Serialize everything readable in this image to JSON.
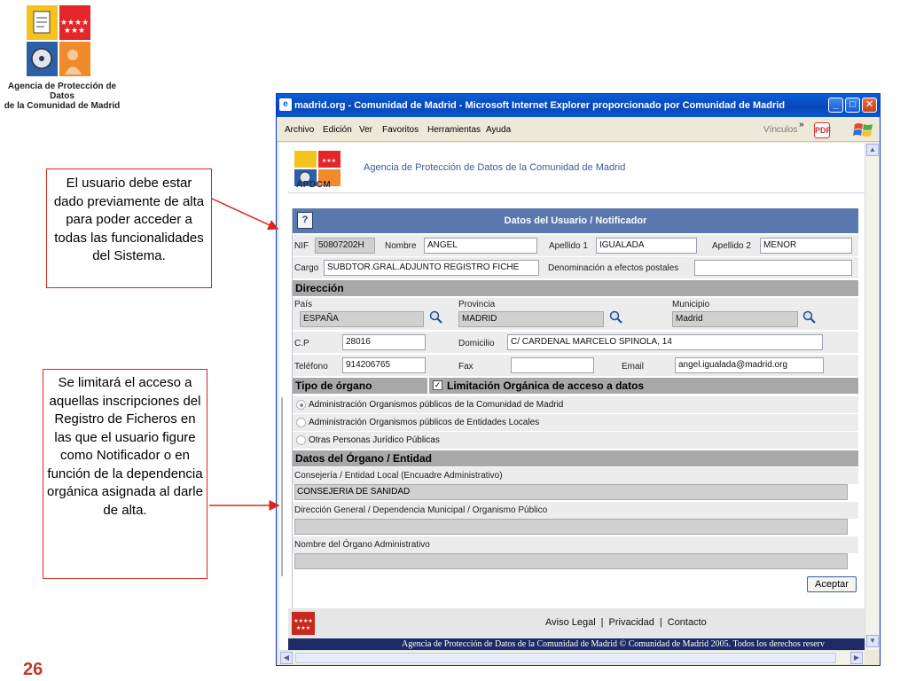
{
  "slide": {
    "logo_caption_line1": "Agencia de Protección de Datos",
    "logo_caption_line2": "de la Comunidad de Madrid",
    "callout_1": "El usuario debe estar dado previamente de alta para poder acceder a todas las funcionalidades del Sistema.",
    "callout_2": "Se limitará el acceso a aquellas inscripciones del Registro de Ficheros en las que el usuario figure como Notificador o en función de la dependencia orgánica asignada al darle de alta.",
    "slide_number": "26",
    "colors": {
      "callout_border": "#d9261c",
      "slide_number": "#c0392b",
      "logo_red": "#e3262a",
      "logo_yellow": "#f5c41c",
      "logo_blue": "#2b5fa8"
    }
  },
  "browser": {
    "title": "madrid.org - Comunidad de Madrid - Microsoft Internet Explorer proporcionado por Comunidad de Madrid",
    "window_buttons": {
      "minimize": "_",
      "maximize": "□",
      "close": "✕"
    },
    "menu": [
      "Archivo",
      "Edición",
      "Ver",
      "Favoritos",
      "Herramientas",
      "Ayuda"
    ],
    "links_label": "Vínculos",
    "chevron": "»",
    "icons": {
      "window_icon": "ie-icon",
      "toolbar_pdf": "pdf-icon",
      "windows_logo": "windows-logo-icon"
    }
  },
  "page": {
    "apdcm_label": "APDCM",
    "agency_header": "Agencia de Protección de Datos de la Comunidad de Madrid",
    "form_title": "Datos del Usuario / Notificador",
    "help_icon": "?",
    "user": {
      "nif_label": "NIF",
      "nif": "50807202H",
      "nombre_label": "Nombre",
      "nombre": "ANGEL",
      "apellido1_label": "Apellido 1",
      "apellido1": "IGUALADA",
      "apellido2_label": "Apellido 2",
      "apellido2": "MENOR",
      "cargo_label": "Cargo",
      "cargo": "SUBDTOR.GRAL.ADJUNTO REGISTRO FICHE",
      "denominacion_label": "Denominación a efectos postales",
      "denominacion": ""
    },
    "direccion": {
      "section": "Dirección",
      "pais_label": "País",
      "pais": "ESPAÑA",
      "provincia_label": "Provincia",
      "provincia": "MADRID",
      "municipio_label": "Municipio",
      "municipio": "Madrid",
      "cp_label": "C.P",
      "cp": "28016",
      "domicilio_label": "Domicilio",
      "domicilio": "C/ CARDENAL MARCELO SPINOLA, 14",
      "telefono_label": "Teléfono",
      "telefono": "914206765",
      "fax_label": "Fax",
      "fax": "",
      "email_label": "Email",
      "email": "angel.igualada@madrid.org"
    },
    "tipo_organo": {
      "section": "Tipo de órgano",
      "limitacion_label": "Limitación Orgánica de acceso a datos",
      "limitacion_checked": true,
      "options": [
        {
          "label": "Administración Organismos públicos de la Comunidad de Madrid",
          "selected": true
        },
        {
          "label": "Administración Organismos públicos de Entidades Locales",
          "selected": false
        },
        {
          "label": "Otras Personas Jurídico Públicas",
          "selected": false
        }
      ]
    },
    "organo": {
      "section": "Datos del Órgano / Entidad",
      "consejeria_label": "Consejería / Entidad Local (Encuadre Administrativo)",
      "consejeria": "CONSEJERIA DE SANIDAD",
      "direccion_general_label": "Dirección General / Dependencia Municipal / Organismo Público",
      "direccion_general": "",
      "nombre_organo_label": "Nombre del Órgano Administrativo",
      "nombre_organo": ""
    },
    "accept_button": "Aceptar",
    "footer": {
      "links": [
        "Aviso Legal",
        "Privacidad",
        "Contacto"
      ],
      "separator": "|",
      "copyright": "Agencia de Protección de Datos de la Comunidad de Madrid © Comunidad de Madrid 2005. Todos los derechos reserv"
    },
    "colors": {
      "form_header": "#5a78ad",
      "section_bar": "#a8a8a8",
      "row_bg": "#ececec",
      "readonly_field": "#d0d0d0",
      "copyright_bar": "#1e2a66"
    }
  }
}
